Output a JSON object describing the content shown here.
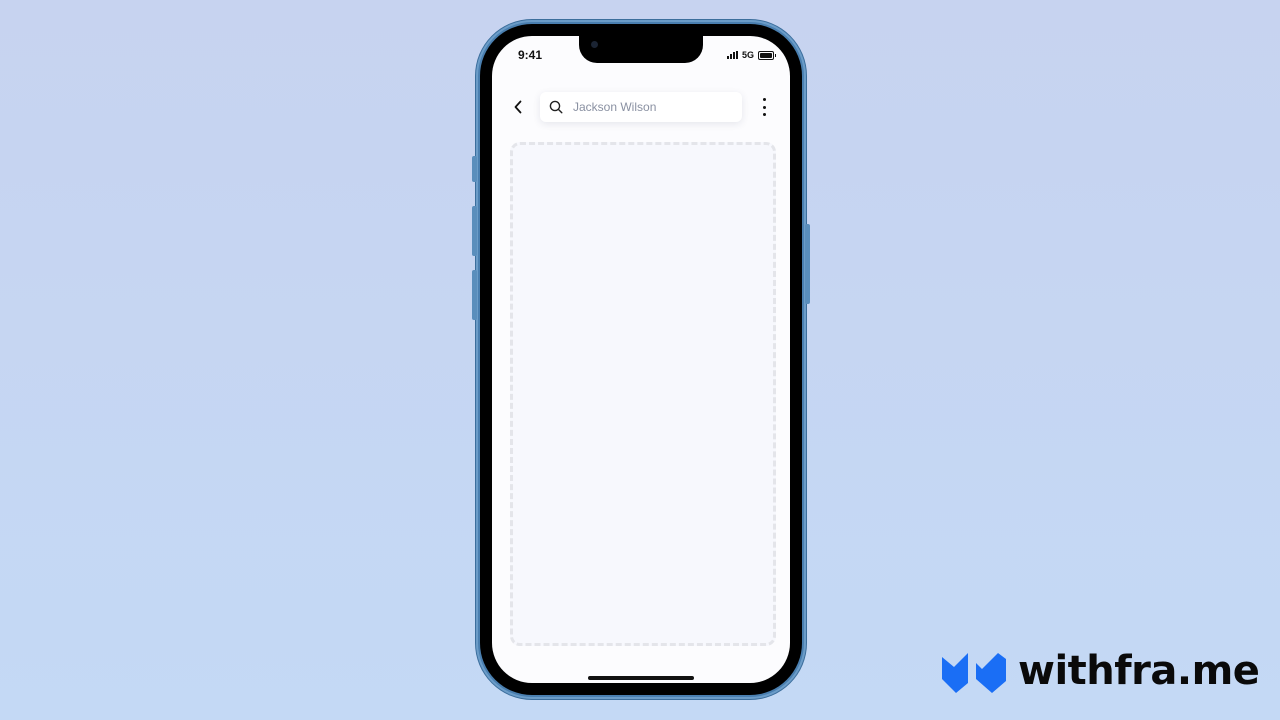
{
  "status_bar": {
    "time": "9:41",
    "network": "5G",
    "icons": [
      "signal-icon",
      "battery-icon"
    ]
  },
  "top_bar": {
    "back_icon": "chevron-left-icon",
    "search": {
      "icon": "search-icon",
      "placeholder": "Jackson Wilson",
      "value": ""
    },
    "more_icon": "more-vertical-icon"
  },
  "content": {
    "placeholder_area": "empty"
  },
  "brand": {
    "name": "withfra.me",
    "logo_color": "#1a6ef5",
    "logo_icon": "withframe-logo-icon"
  }
}
